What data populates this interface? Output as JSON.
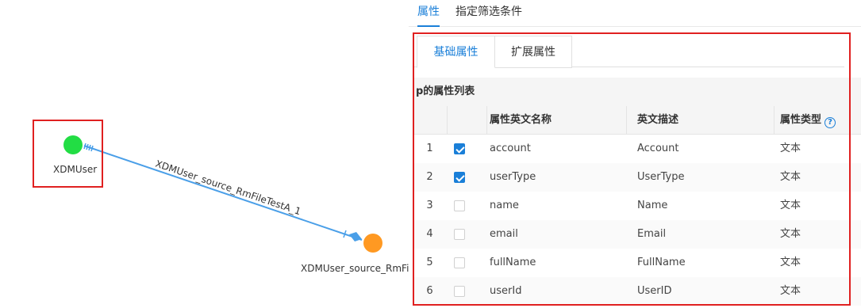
{
  "diagram": {
    "nodes": [
      {
        "id": "xdmuser",
        "label": "XDMUser",
        "color": "#22dd44"
      },
      {
        "id": "source",
        "label": "XDMUser_source_RmFil",
        "color": "#ff9922"
      }
    ],
    "edge_label": "XDMUser_source_RmFileTestA_1",
    "edge_color": "#4a9fe8",
    "selection_color": "#e02020"
  },
  "panel": {
    "top_tabs": [
      {
        "label": "属性",
        "active": true
      },
      {
        "label": "指定筛选条件",
        "active": false
      }
    ],
    "sub_tabs": [
      {
        "label": "基础属性",
        "active": true
      },
      {
        "label": "扩展属性",
        "active": false
      }
    ],
    "list_title": "p的属性列表",
    "columns": {
      "name": "属性英文名称",
      "desc": "英文描述",
      "type": "属性类型"
    },
    "rows": [
      {
        "index": "1",
        "checked": true,
        "name": "account",
        "desc": "Account",
        "type": "文本"
      },
      {
        "index": "2",
        "checked": true,
        "name": "userType",
        "desc": "UserType",
        "type": "文本"
      },
      {
        "index": "3",
        "checked": false,
        "name": "name",
        "desc": "Name",
        "type": "文本"
      },
      {
        "index": "4",
        "checked": false,
        "name": "email",
        "desc": "Email",
        "type": "文本"
      },
      {
        "index": "5",
        "checked": false,
        "name": "fullName",
        "desc": "FullName",
        "type": "文本"
      },
      {
        "index": "6",
        "checked": false,
        "name": "userId",
        "desc": "UserID",
        "type": "文本"
      }
    ],
    "accent_color": "#1a7fd8"
  }
}
